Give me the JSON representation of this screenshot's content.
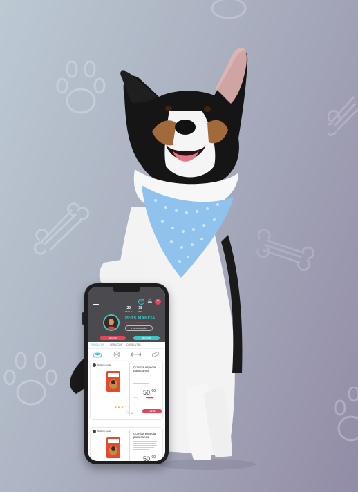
{
  "colors": {
    "accent": "#3cc7c7",
    "brand_red": "#e2465a",
    "header_bg": "#4a4a4f"
  },
  "profile": {
    "stats": [
      {
        "number": "20",
        "label": "SEGUE"
      },
      {
        "number": "38",
        "label": "PRO."
      }
    ],
    "name": "PETS MARCIA",
    "subtitle": "SEGUE · 1 SEGUIDORES",
    "info_button": "+ INFORMAÇÃO",
    "follow_button": "SEGUIR",
    "message_button": "MENSAJE"
  },
  "header_icons": [
    "whatsapp-icon",
    "bell-icon",
    "add-icon"
  ],
  "tabs": [
    "PRODUTOS",
    "SERVIÇOS",
    "CONSULTAS"
  ],
  "categories": [
    "dog-bed-icon",
    "ball-icon",
    "bone-icon",
    "bandage-icon"
  ],
  "products": [
    {
      "seller": "Sublime Looks",
      "title": "Comida especial para canes",
      "price": "50.",
      "price_cents": "00",
      "old_label": "Antes",
      "old_price": "70.00",
      "rating": 3,
      "buy_label": "LLEVE"
    },
    {
      "seller": "Sublime Looks",
      "title": "Comida especial para canes",
      "price": "50.",
      "price_cents": "00"
    }
  ]
}
